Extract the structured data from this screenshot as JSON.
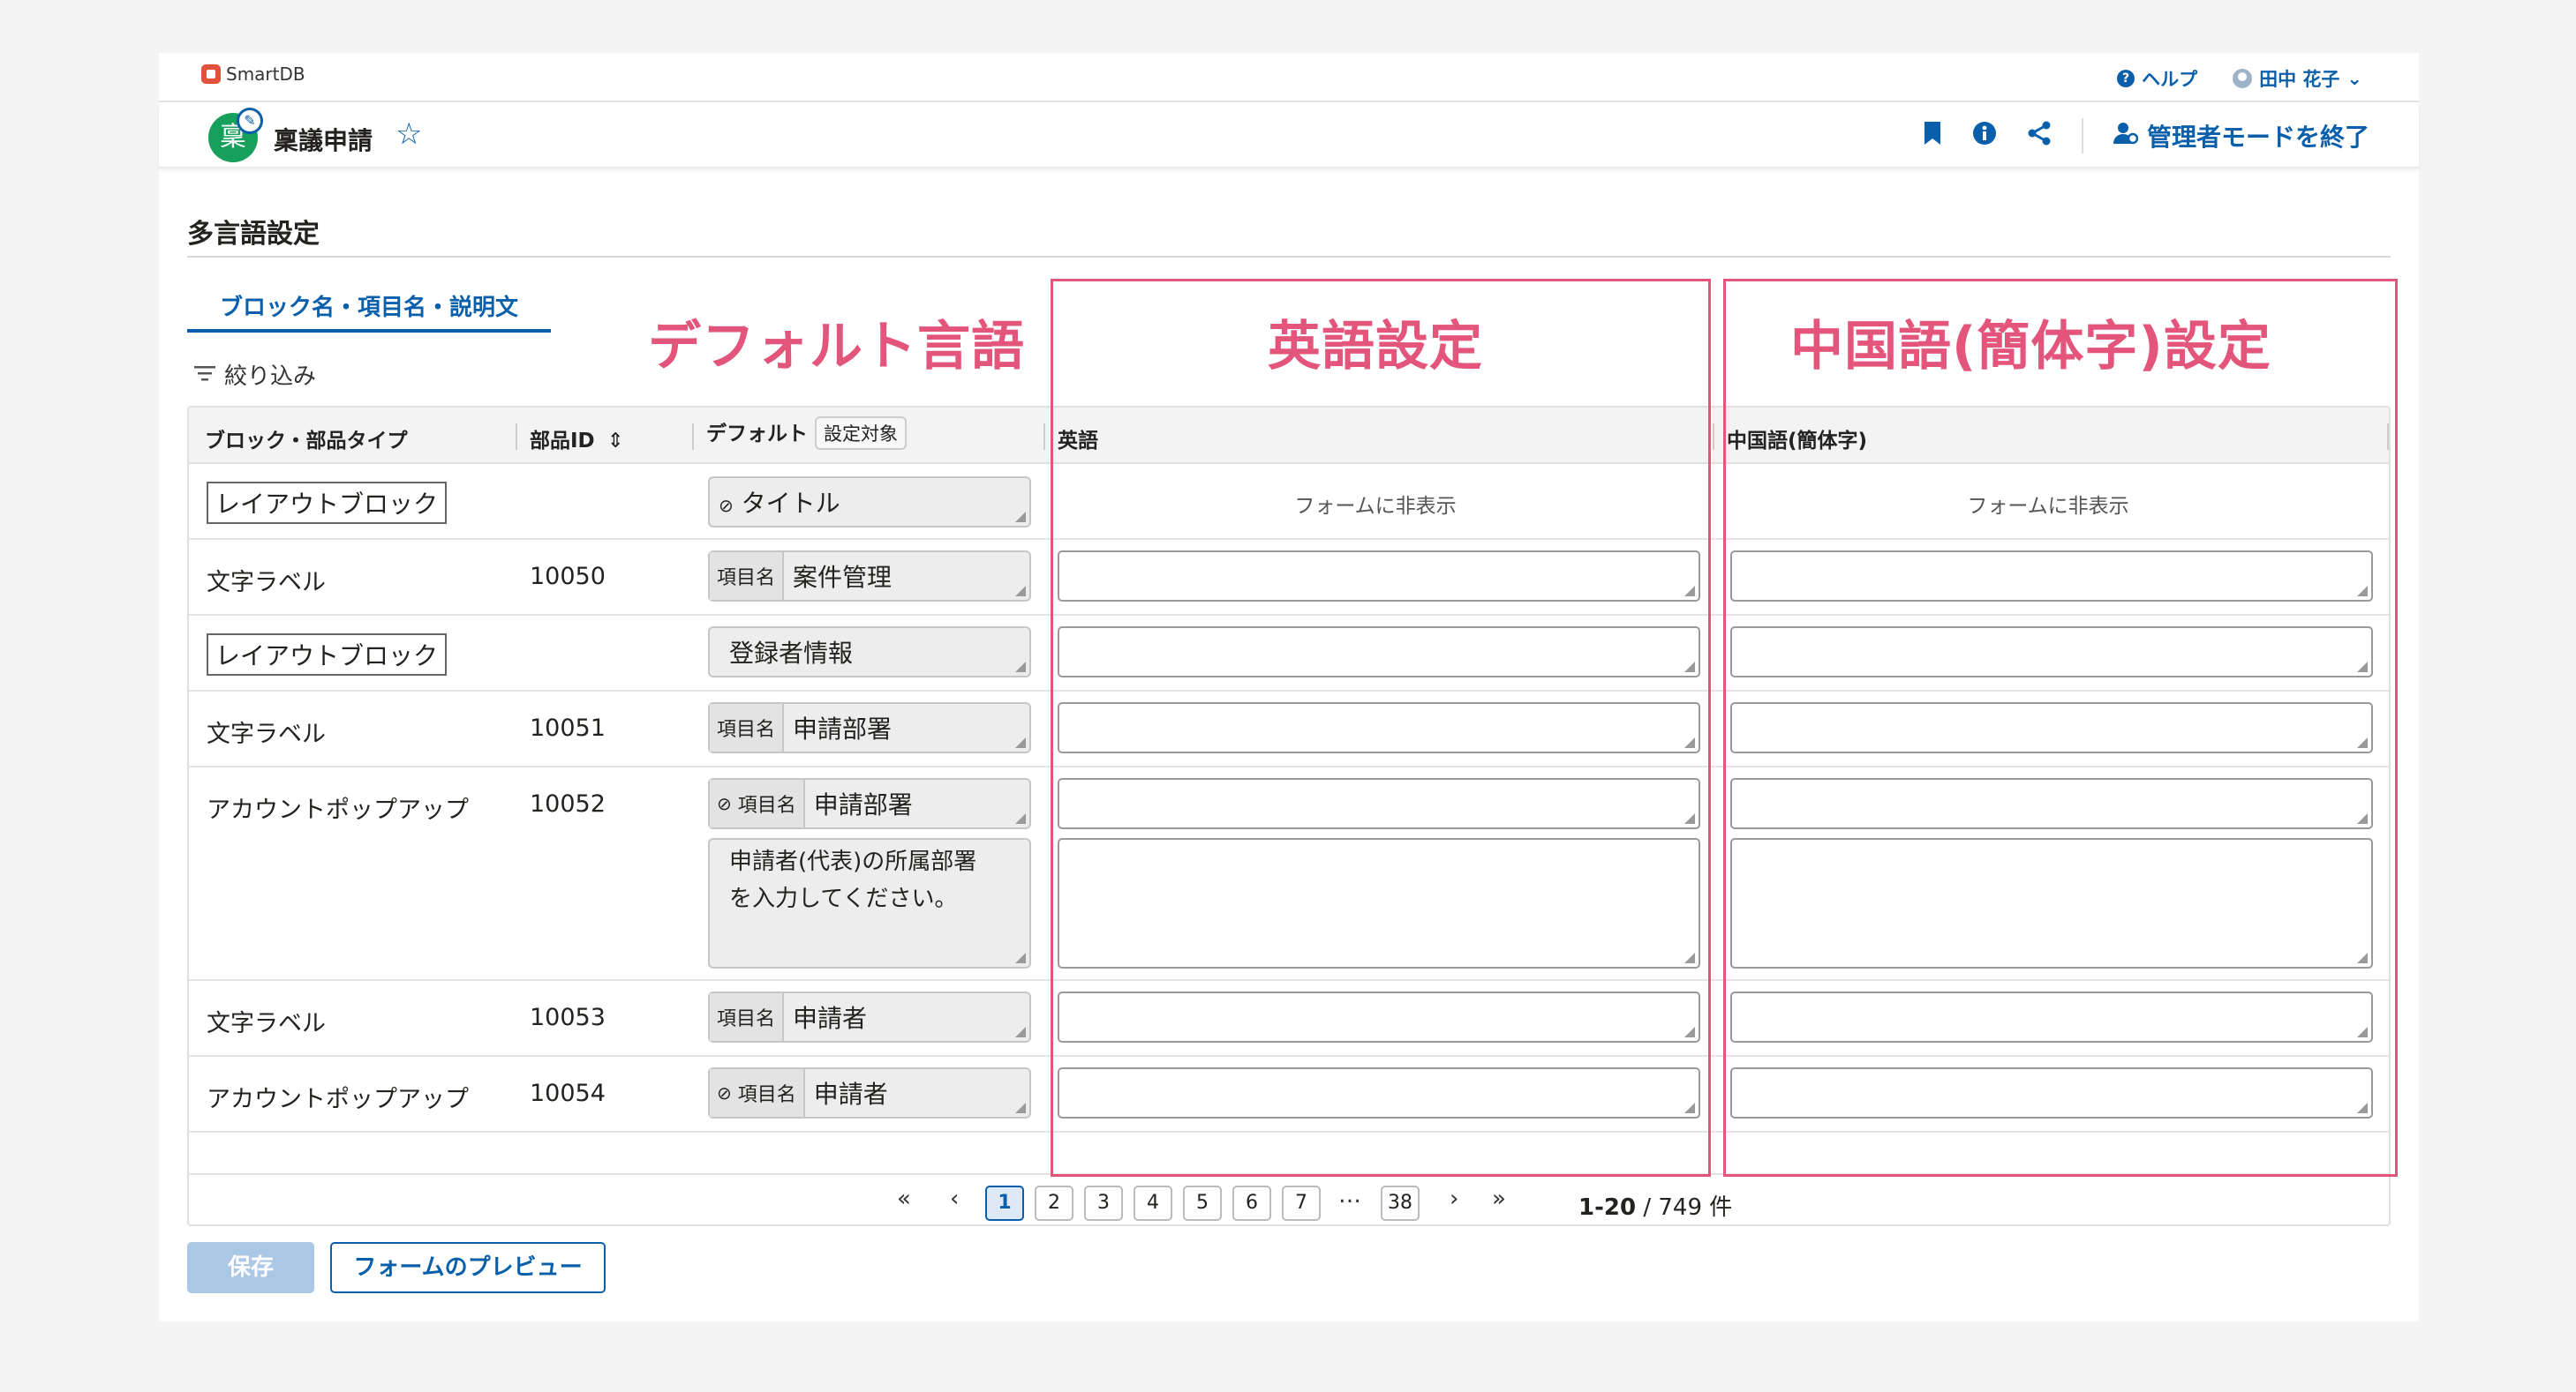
{
  "brand": {
    "name": "SmartDB"
  },
  "top_nav": {
    "help": "ヘルプ",
    "user": "田中 花子"
  },
  "app": {
    "icon_char": "稟",
    "title": "稟議申請",
    "exit_admin": "管理者モードを終了"
  },
  "page": {
    "title": "多言語設定",
    "tab": "ブロック名・項目名・説明文",
    "filter": "絞り込み"
  },
  "table": {
    "headers": {
      "type": "ブロック・部品タイプ",
      "id": "部品ID",
      "default": "デフォルト",
      "target_button": "設定対象",
      "english": "英語",
      "chinese": "中国語(簡体字)"
    },
    "field_label": "項目名",
    "hidden_note": "フォームに非表示",
    "rows": [
      {
        "type": "レイアウトブロック",
        "id": "",
        "default": "タイトル"
      },
      {
        "type": "文字ラベル",
        "id": "10050",
        "default": "案件管理"
      },
      {
        "type": "レイアウトブロック",
        "id": "",
        "default": "登録者情報"
      },
      {
        "type": "文字ラベル",
        "id": "10051",
        "default": "申請部署"
      },
      {
        "type": "アカウントポップアップ",
        "id": "10052",
        "default": "申請部署",
        "description_line1": "申請者(代表)の所属部署",
        "description_line2": "を入力してください。"
      },
      {
        "type": "文字ラベル",
        "id": "10053",
        "default": "申請者"
      },
      {
        "type": "アカウントポップアップ",
        "id": "10054",
        "default": "申請者"
      }
    ]
  },
  "pagination": {
    "pages": [
      "1",
      "2",
      "3",
      "4",
      "5",
      "6",
      "7",
      "…",
      "38"
    ],
    "current": "1",
    "range": "1-20",
    "total": "/ 749 件"
  },
  "buttons": {
    "save": "保存",
    "preview": "フォームのプレビュー"
  },
  "annotations": {
    "default_lang": "デフォルト言語",
    "english_setting": "英語設定",
    "chinese_setting": "中国語(簡体字)設定",
    "color": "#e3557a"
  },
  "colors": {
    "accent": "#0a5fab",
    "app_icon": "#16a05b"
  }
}
